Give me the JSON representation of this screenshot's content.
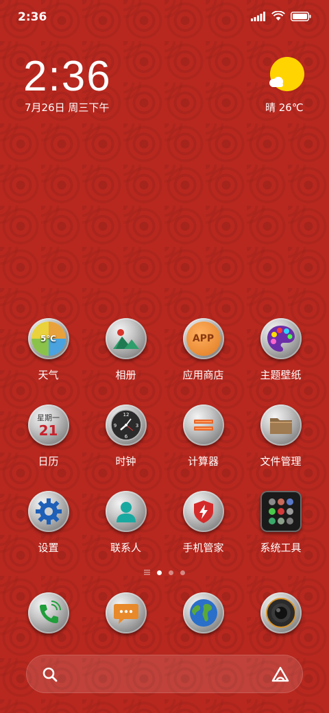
{
  "status_bar": {
    "time": "2:36"
  },
  "clock_widget": {
    "time": "2:36",
    "date": "7月26日 周三下午"
  },
  "weather_widget": {
    "text": "晴 26℃"
  },
  "apps": [
    {
      "label": "天气",
      "icon": "weather-icon",
      "badge": "5℃"
    },
    {
      "label": "相册",
      "icon": "gallery-icon"
    },
    {
      "label": "应用商店",
      "icon": "app-store-icon",
      "badge": "APP"
    },
    {
      "label": "主题壁纸",
      "icon": "palette-icon"
    },
    {
      "label": "日历",
      "icon": "calendar-icon",
      "weekday": "星期一",
      "day": "21"
    },
    {
      "label": "时钟",
      "icon": "clock-icon"
    },
    {
      "label": "计算器",
      "icon": "calculator-icon"
    },
    {
      "label": "文件管理",
      "icon": "folder-icon"
    },
    {
      "label": "设置",
      "icon": "gear-icon"
    },
    {
      "label": "联系人",
      "icon": "contact-icon"
    },
    {
      "label": "手机管家",
      "icon": "shield-icon"
    },
    {
      "label": "系统工具",
      "icon": "tools-icon"
    }
  ],
  "dock": [
    {
      "icon": "phone-icon"
    },
    {
      "icon": "message-icon"
    },
    {
      "icon": "browser-icon"
    },
    {
      "icon": "camera-icon"
    }
  ],
  "page_indicator": {
    "pages": 3,
    "active": 1
  },
  "colors": {
    "wallpaper": "#b8281f",
    "accent_yellow": "#ffd400"
  }
}
